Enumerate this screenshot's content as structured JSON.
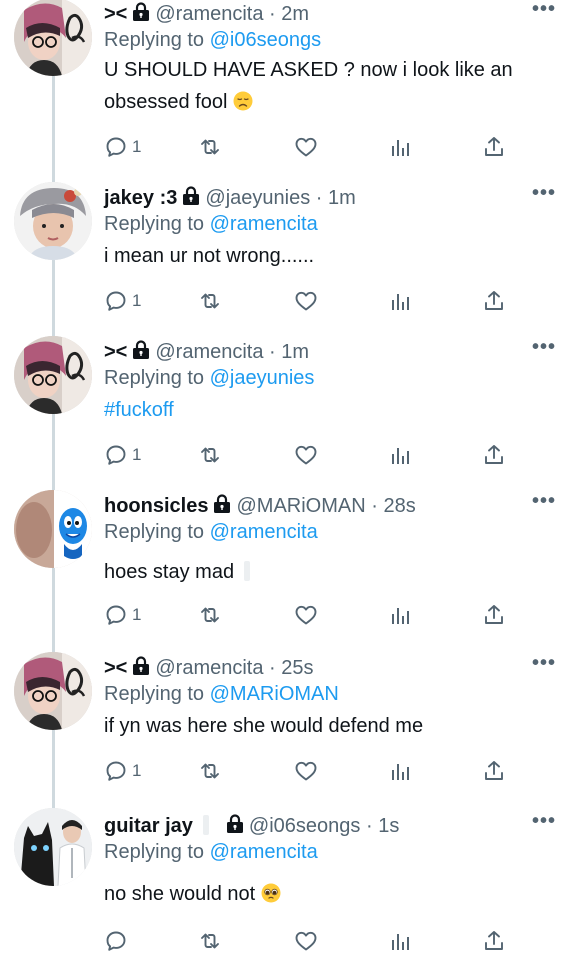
{
  "tweets": [
    {
      "name": "><",
      "handle": "@ramencita",
      "time": "2m",
      "reply_prefix": "Replying to",
      "reply_to": "@i06seongs",
      "text_line1": "U SHOULD HAVE ASKED ? now i look like an",
      "text_line2": "obsessed fool",
      "emoji": "disappointed-face",
      "replies": "1",
      "avatar": "dark-hair-glasses"
    },
    {
      "name": "jakey :3",
      "handle": "@jaeyunies",
      "time": "1m",
      "reply_prefix": "Replying to",
      "reply_to": "@ramencita",
      "text_line1": "i mean ur not wrong......",
      "replies": "1",
      "avatar": "ash-hair-bear"
    },
    {
      "name": "><",
      "handle": "@ramencita",
      "time": "1m",
      "reply_prefix": "Replying to",
      "reply_to": "@jaeyunies",
      "hashtag": "#fuckoff",
      "replies": "1",
      "avatar": "dark-hair-glasses"
    },
    {
      "name": "hoonsicles",
      "handle": "@MARiOMAN",
      "time": "28s",
      "reply_prefix": "Replying to",
      "reply_to": "@ramencita",
      "text_line1": "hoes stay mad",
      "replies": "1",
      "avatar": "blue-mascot"
    },
    {
      "name": "><",
      "handle": "@ramencita",
      "time": "25s",
      "reply_prefix": "Replying to",
      "reply_to": "@MARiOMAN",
      "text_line1": "if yn was here she would defend me",
      "replies": "1",
      "avatar": "dark-hair-glasses"
    },
    {
      "name": "guitar jay",
      "handle": "@i06seongs",
      "time": "1s",
      "reply_prefix": "Replying to",
      "reply_to": "@ramencita",
      "text_line1": "no she would not",
      "emoji": "pleading-face",
      "replies": "",
      "avatar": "black-cat-white-shirt"
    }
  ],
  "separator": "·",
  "more_label": "•••",
  "colors": {
    "link": "#1d9bf0",
    "muted": "#536471",
    "text": "#0f1419",
    "thread_line": "#cfd9de"
  }
}
